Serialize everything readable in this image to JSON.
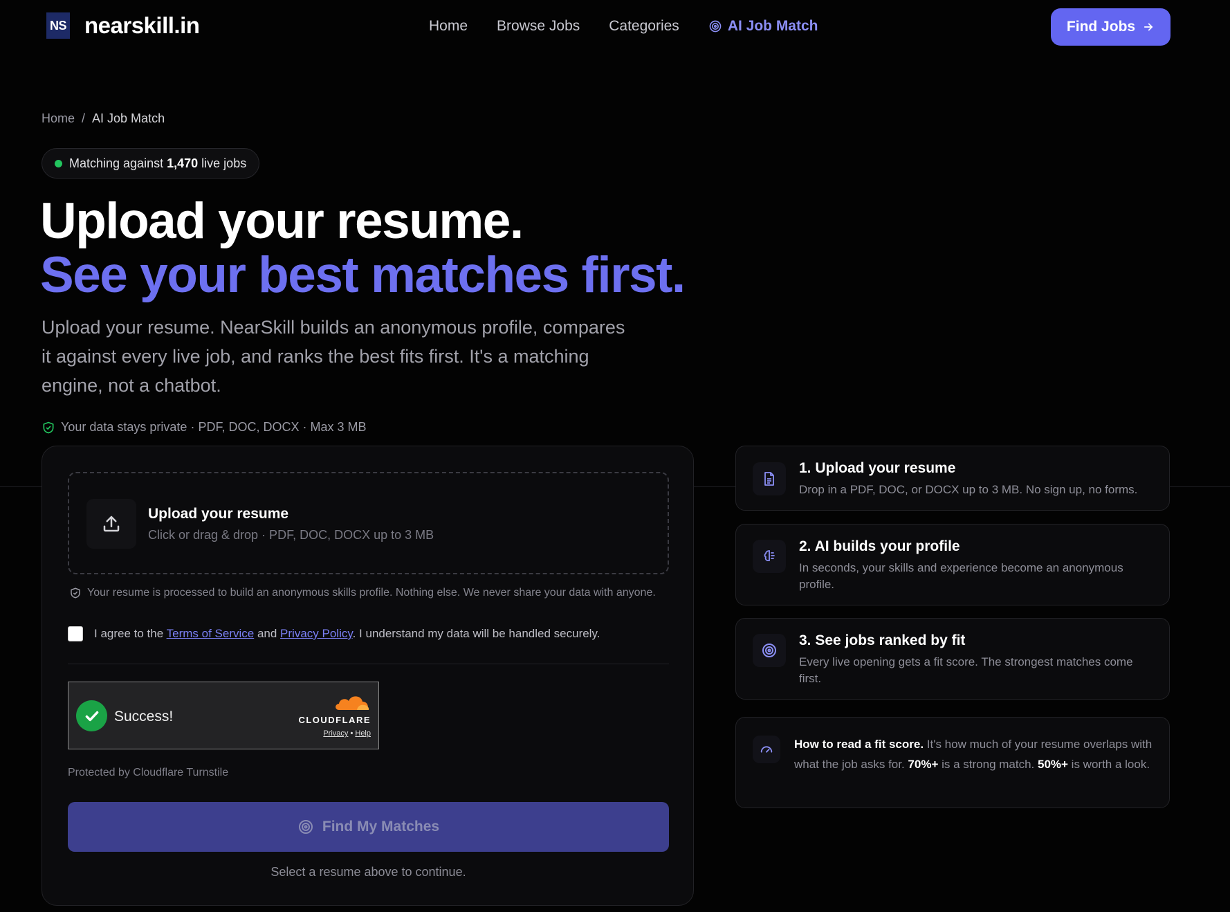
{
  "nav": {
    "logo_badge": "NS",
    "logo_text": "nearskill.in",
    "links": [
      "Home",
      "Browse Jobs",
      "Categories"
    ],
    "active_link": "AI Job Match",
    "cta": "Find Jobs",
    "cta_icon": "arrow-right-icon"
  },
  "breadcrumb": {
    "home": "Home",
    "separator": "/",
    "current": "AI Job Match"
  },
  "status": {
    "prefix": "Matching against",
    "count": "1,470",
    "suffix": "live jobs",
    "color": "#22c55e"
  },
  "hero": {
    "line1": "Upload your resume.",
    "line2": "See your best matches first.",
    "lead": "Upload your resume. NearSkill builds an anonymous profile, compares it against every live job, and ranks the best fits first. It's a matching engine, not a chatbot.",
    "privacy": "Your data stays private · PDF, DOC, DOCX · Max 3 MB"
  },
  "upload": {
    "title": "Upload your resume",
    "subtitle": "Click or drag & drop · PDF, DOC, DOCX up to 3 MB",
    "secure_note": "Your resume is processed to build an anonymous skills profile. Nothing else. We never share your data with anyone.",
    "agree_prefix": "I agree to the",
    "terms": "Terms of Service",
    "and": "and",
    "privacy": "Privacy Policy",
    "agree_suffix": ". I understand my data will be handled securely.",
    "turnstile_status": "Success!",
    "turnstile_brand": "CLOUDFLARE",
    "turnstile_privacy": "Privacy",
    "turnstile_dot": "•",
    "turnstile_help": "Help",
    "turnstile_caption": "Protected by Cloudflare Turnstile",
    "button": "Find My Matches",
    "continue_note": "Select a resume above to continue."
  },
  "steps": [
    {
      "title": "1. Upload your resume",
      "desc": "Drop in a PDF, DOC, or DOCX up to 3 MB. No sign up, no forms.",
      "icon": "document-icon"
    },
    {
      "title": "2. AI builds your profile",
      "desc": "In seconds, your skills and experience become an anonymous profile.",
      "icon": "brain-icon"
    },
    {
      "title": "3. See jobs ranked by fit",
      "desc": "Every live opening gets a fit score. The strongest matches come first.",
      "icon": "target-icon"
    }
  ],
  "tip": {
    "lead": "How to read a fit score.",
    "text1": " It's how much of your resume overlaps with what the job asks for. ",
    "strong": "70%+",
    "text2": " is a strong match. ",
    "ok": "50%+",
    "text3": " is worth a look.",
    "icon": "gauge-icon"
  },
  "colors": {
    "accent": "#6366f1",
    "accent_text": "#6d70f0",
    "background": "#030303"
  }
}
